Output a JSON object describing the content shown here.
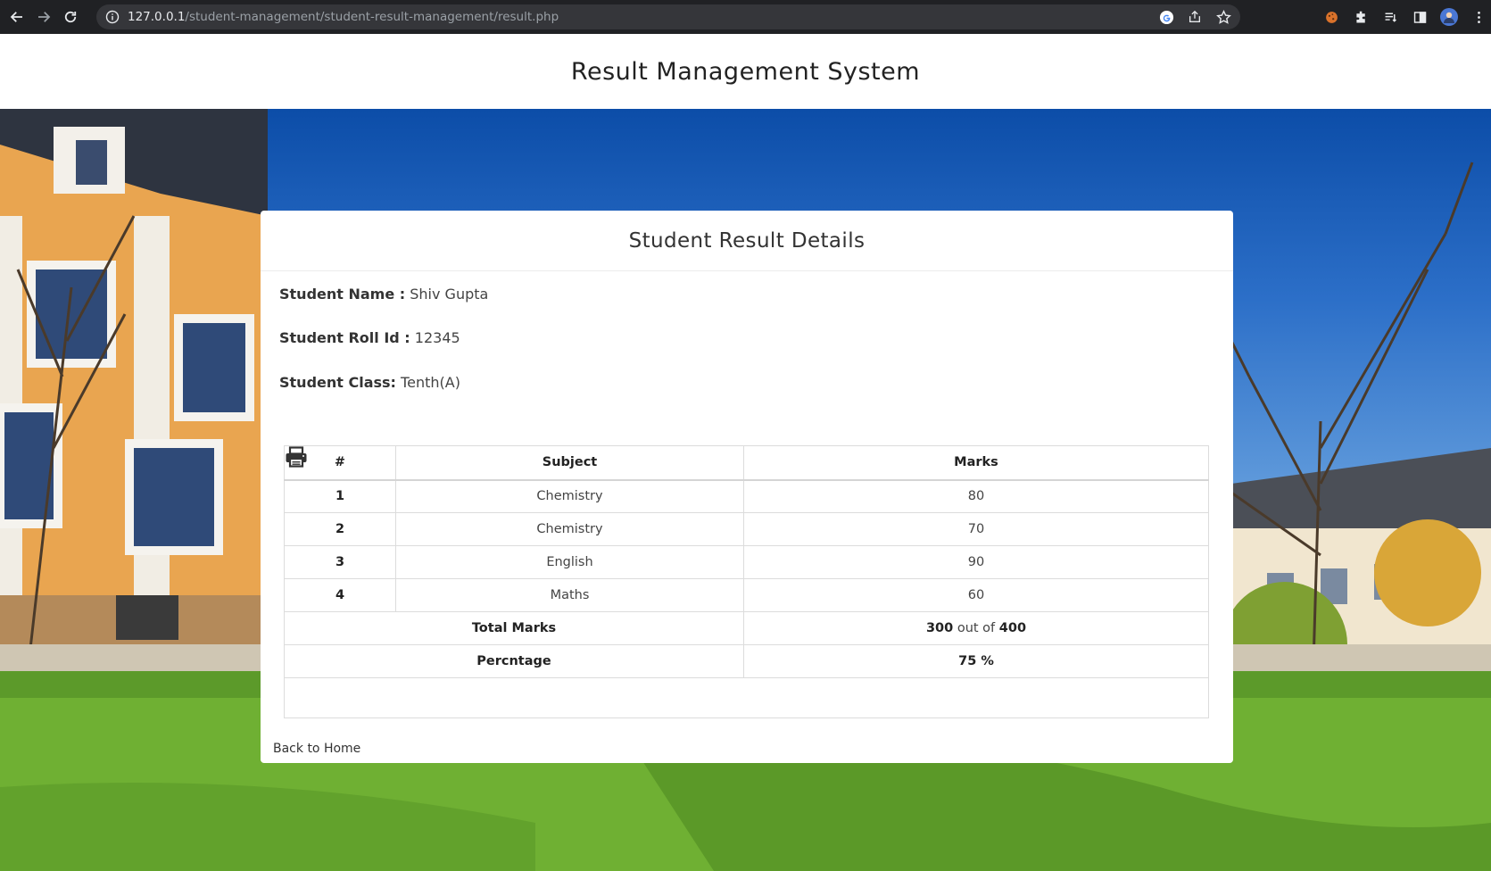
{
  "browser": {
    "url_host": "127.0.0.1",
    "url_path": "/student-management/student-result-management/result.php"
  },
  "header": {
    "title": "Result Management System"
  },
  "card": {
    "title": "Student Result Details",
    "student_name_label": "Student Name :",
    "student_name": "Shiv Gupta",
    "roll_label": "Student Roll Id :",
    "roll_id": "12345",
    "class_label": "Student Class:",
    "class_value": "Tenth(A)"
  },
  "table": {
    "headers": [
      "#",
      "Subject",
      "Marks"
    ],
    "rows": [
      {
        "num": "1",
        "subject": "Chemistry",
        "marks": "80"
      },
      {
        "num": "2",
        "subject": "Chemistry",
        "marks": "70"
      },
      {
        "num": "3",
        "subject": "English",
        "marks": "90"
      },
      {
        "num": "4",
        "subject": "Maths",
        "marks": "60"
      }
    ],
    "total_label": "Total Marks",
    "total_obtained": "300",
    "total_out_of": "out of",
    "total_max": "400",
    "percentage_label": "Percntage",
    "percentage_value": "75 %"
  },
  "back_link": "Back to Home"
}
